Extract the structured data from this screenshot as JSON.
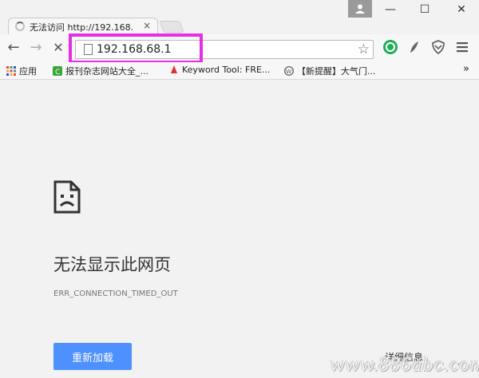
{
  "tab": {
    "title": "无法访问 http://192.168.",
    "close": "×"
  },
  "window": {
    "minimize": "—",
    "maximize": "☐",
    "close": "✕"
  },
  "toolbar": {
    "back": "←",
    "forward": "→",
    "stop": "✕",
    "url": "192.168.68.1",
    "star": "☆"
  },
  "bookmarks": [
    {
      "label": "应用"
    },
    {
      "label": "报刊杂志网站大全_..."
    },
    {
      "label": "Keyword Tool: FRE..."
    },
    {
      "label": "【新提醒】大气门..."
    }
  ],
  "more": "»",
  "error": {
    "title": "无法显示此网页",
    "code": "ERR_CONNECTION_TIMED_OUT",
    "reload": "重新加载",
    "details": "详细信息"
  },
  "watermark": "www.886abc.com",
  "colors": {
    "highlight": "#e62ee6",
    "reload_button": "#4d90fe"
  }
}
